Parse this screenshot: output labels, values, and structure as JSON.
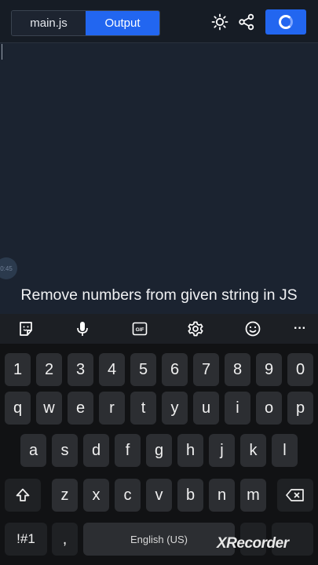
{
  "tabs": [
    {
      "label": "main.js",
      "active": false
    },
    {
      "label": "Output",
      "active": true
    }
  ],
  "header": {
    "theme_icon": "sun-icon",
    "share_icon": "share-icon",
    "run_icon": "spinner-icon"
  },
  "editor": {
    "bubble_text": "0:45"
  },
  "caption": "Remove numbers from given string in JS",
  "toolbar": {
    "icons": [
      "sticker-icon",
      "microphone-icon",
      "gif-icon",
      "gear-icon",
      "emoji-icon",
      "more-icon"
    ],
    "gif_label": "GIF",
    "more_label": "···"
  },
  "keyboard": {
    "row1": [
      "1",
      "2",
      "3",
      "4",
      "5",
      "6",
      "7",
      "8",
      "9",
      "0"
    ],
    "row2": [
      "q",
      "w",
      "e",
      "r",
      "t",
      "y",
      "u",
      "i",
      "o",
      "p"
    ],
    "row3": [
      "a",
      "s",
      "d",
      "f",
      "g",
      "h",
      "j",
      "k",
      "l"
    ],
    "row4": [
      "z",
      "x",
      "c",
      "v",
      "b",
      "n",
      "m"
    ],
    "symbols": "!#1",
    "comma": ",",
    "space": "English (US)",
    "shift_icon": "shift-icon",
    "backspace_icon": "backspace-icon"
  },
  "watermark": "XRecorder",
  "colors": {
    "accent": "#2266f0",
    "editor_bg": "#1b2330",
    "keyboard_bg": "#111214",
    "key_bg": "#2c2e32"
  }
}
